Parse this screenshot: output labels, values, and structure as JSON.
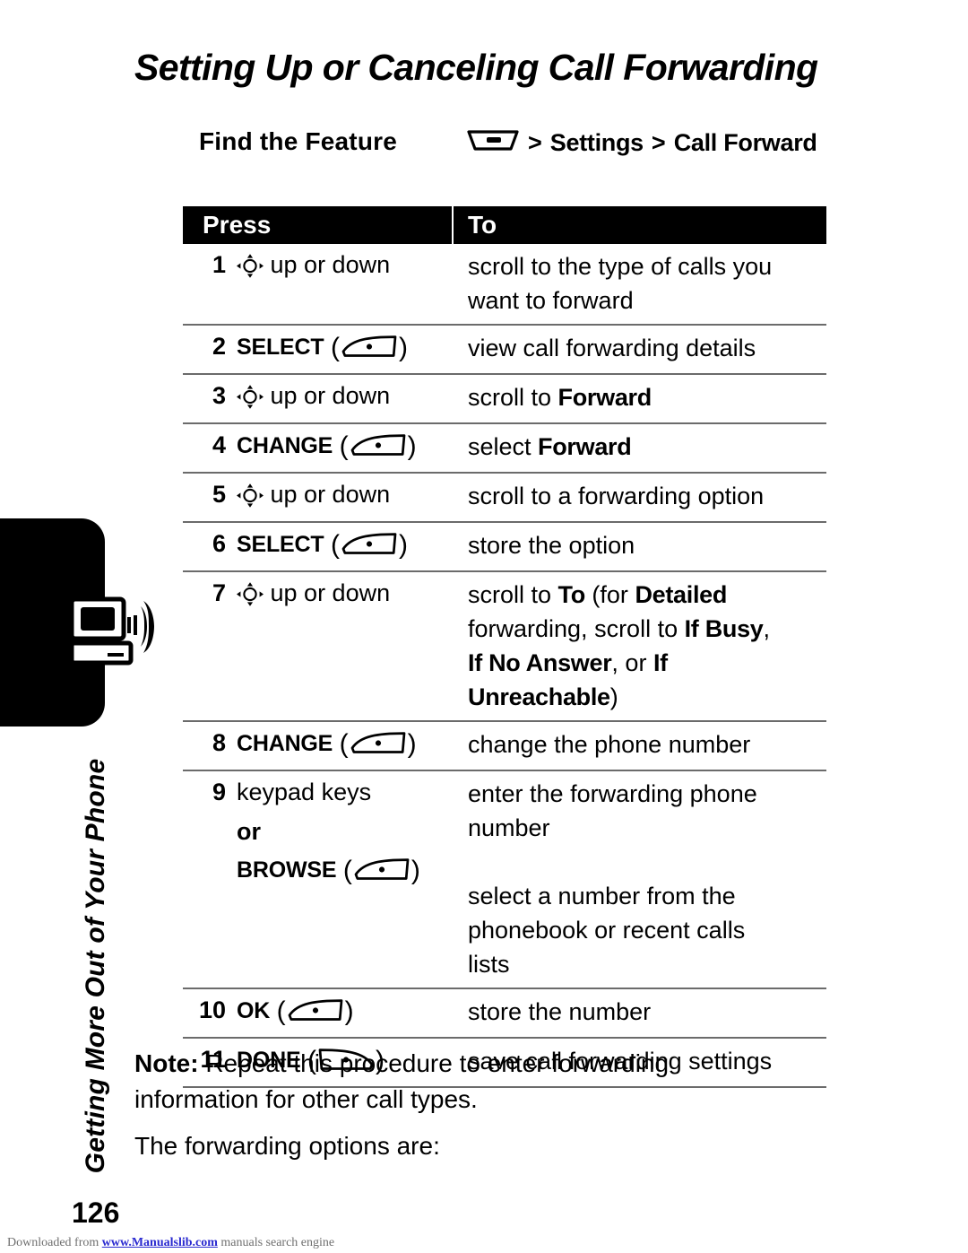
{
  "document": {
    "title": "Setting Up or Canceling Call Forwarding",
    "page_number": "126",
    "side_tab_label": "Getting More Out of Your Phone",
    "side_tab_icon": "computer-phone-icon"
  },
  "find_feature": {
    "label": "Find the Feature",
    "menu_key_icon": "menu-key-icon",
    "separator_1": ">",
    "path_1": "Settings",
    "separator_2": ">",
    "path_2": "Call Forward"
  },
  "table": {
    "headers": {
      "press": "Press",
      "to": "To"
    },
    "rows": [
      {
        "num": "1",
        "press_icon": "nav-key-icon",
        "press_text": "up or down",
        "to_lines": [
          "scroll to the type of calls you",
          "want to forward"
        ]
      },
      {
        "num": "2",
        "press_key": "SELECT",
        "press_icon": "left-soft-key-icon",
        "to_lines": [
          "view call forwarding details"
        ]
      },
      {
        "num": "3",
        "press_icon": "nav-key-icon",
        "press_text": "up or down",
        "to_prefix": "scroll to ",
        "to_keyword": "Forward"
      },
      {
        "num": "4",
        "press_key": "CHANGE",
        "press_icon": "left-soft-key-icon",
        "to_prefix": "select ",
        "to_keyword": "Forward"
      },
      {
        "num": "5",
        "press_icon": "nav-key-icon",
        "press_text": "up or down",
        "to_lines": [
          "scroll to a forwarding option"
        ]
      },
      {
        "num": "6",
        "press_key": "SELECT",
        "press_icon": "left-soft-key-icon",
        "to_lines": [
          "store the option"
        ]
      },
      {
        "num": "7",
        "press_icon": "nav-key-icon",
        "press_text": "up or down",
        "to_rich": {
          "l1a": "scroll to ",
          "l1b": "To",
          "l1c": " (for ",
          "l1d": "Detailed",
          "l2a": "forwarding, scroll to ",
          "l2b": "If Busy",
          "l2c": ",",
          "l3a": "If No Answer",
          "l3b": ", or ",
          "l3c": "If Unreachable",
          "l3d": ")"
        }
      },
      {
        "num": "8",
        "press_key": "CHANGE",
        "press_icon": "left-soft-key-icon",
        "to_lines": [
          "change the phone number"
        ]
      },
      {
        "num": "9",
        "press_text": "keypad keys",
        "press_or": "or",
        "press_key2": "BROWSE",
        "press_icon2": "left-soft-key-icon",
        "to_lines": [
          "enter the forwarding phone",
          "number"
        ],
        "to_lines2": [
          "select a number from the",
          "phonebook or recent calls",
          "lists"
        ]
      },
      {
        "num": "10",
        "press_key": "OK",
        "press_icon": "left-soft-key-icon",
        "to_lines": [
          "store the number"
        ]
      },
      {
        "num": "11",
        "press_key": "DONE",
        "press_icon": "right-soft-key-icon",
        "to_lines": [
          "save call forwarding settings"
        ]
      }
    ]
  },
  "note": {
    "label": "Note:",
    "text": " Repeat this procedure to enter forwarding information for other call types.",
    "follow_up": "The forwarding options are:"
  },
  "footer": {
    "prefix": "Downloaded from ",
    "link": "www.Manualslib.com",
    "suffix": " manuals search engine"
  }
}
